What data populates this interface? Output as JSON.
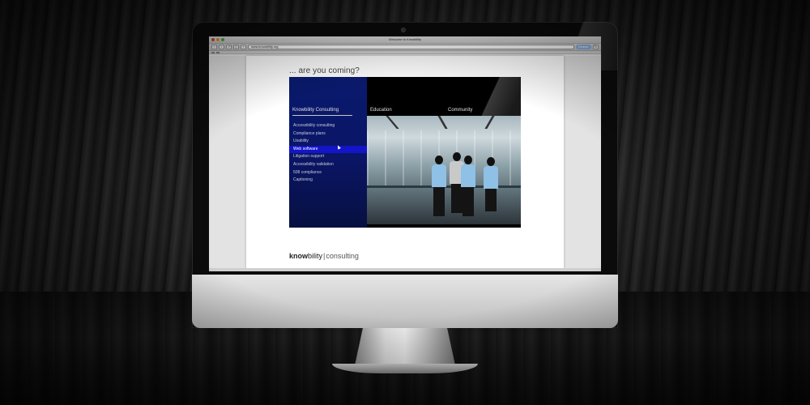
{
  "browser": {
    "window_title": "Welcome to Knowbility",
    "url": "www.knowbility.org",
    "reader_label": "Reader",
    "nav_back_icon": "chevron-left-icon",
    "nav_forward_icon": "chevron-right-icon"
  },
  "site": {
    "tagline": "... are you coming?",
    "sections": [
      "Knowbility Consulting",
      "Education",
      "Community"
    ],
    "nav_items": [
      "Accessibility consulting",
      "Compliance plans",
      "Usability",
      "Web software",
      "Litigation support",
      "Accessibility validation",
      "508 compliance",
      "Captioning"
    ],
    "active_item": "Web software",
    "logo": {
      "bold": "know",
      "rest": "bility",
      "divider": "|",
      "suffix": "consulting"
    }
  },
  "colors": {
    "nav_bg": "#0a1a6e",
    "nav_active": "#1414c8",
    "shirt": "#8fc0e6"
  }
}
